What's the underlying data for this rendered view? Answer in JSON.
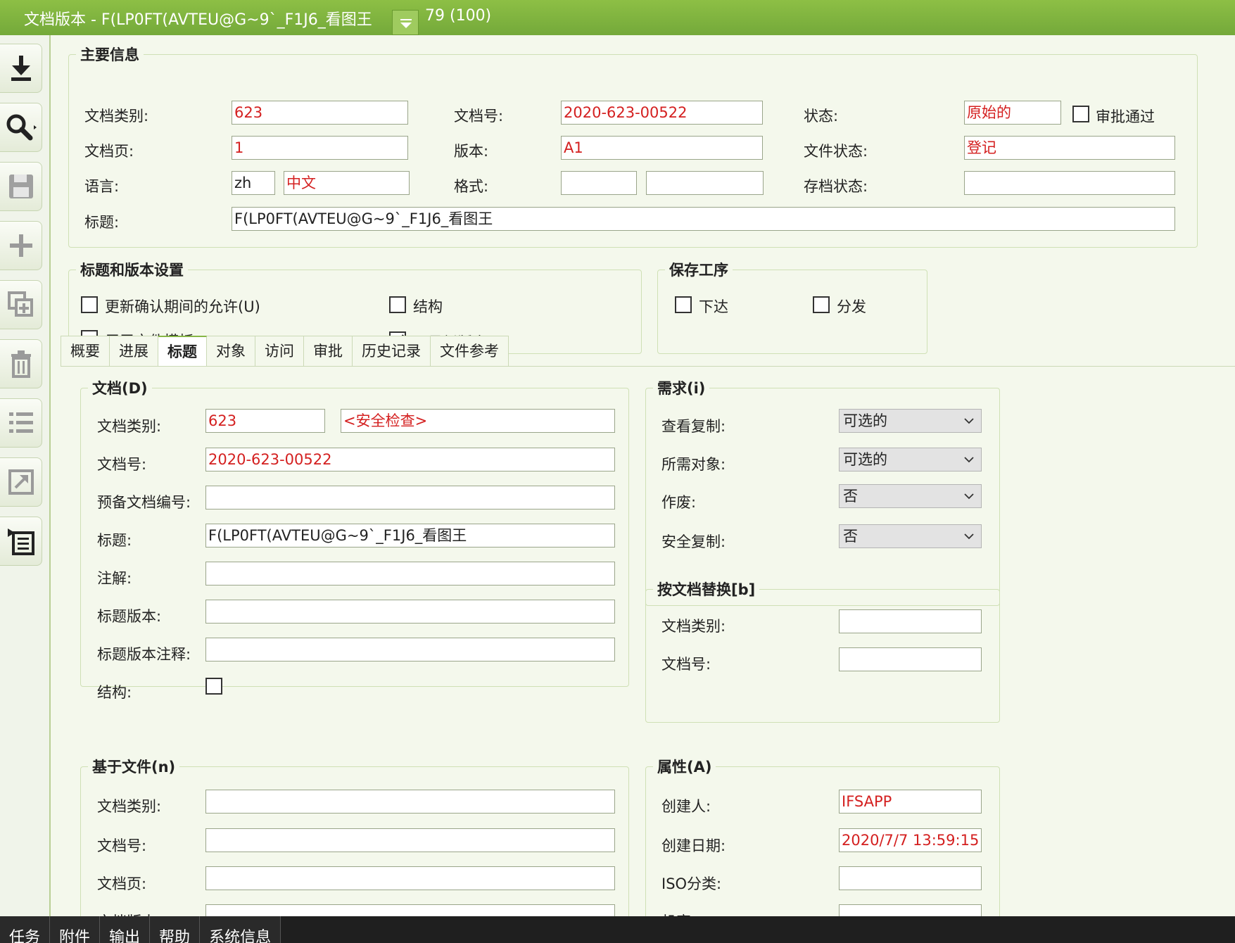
{
  "window": {
    "title": "文档版本 - F(LP0FT(AVTEU@G~9`_F1J6_看图王",
    "record_count": "79 (100)"
  },
  "toolbar": {
    "icons": [
      "download-icon",
      "search-icon",
      "save-icon",
      "add-icon",
      "duplicate-icon",
      "delete-icon",
      "list-icon",
      "export-icon",
      "details-icon"
    ]
  },
  "main_info": {
    "legend": "主要信息",
    "doc_class_label": "文档类别:",
    "doc_class": "623",
    "doc_no_label": "文档号:",
    "doc_no": "2020-623-00522",
    "status_label": "状态:",
    "status": "原始的",
    "approved_label": "审批通过",
    "approved": false,
    "doc_sheet_label": "文档页:",
    "doc_sheet": "1",
    "revision_label": "版本:",
    "revision": "A1",
    "file_status_label": "文件状态:",
    "file_status": "登记",
    "language_label": "语言:",
    "language_code": "zh",
    "language_name": "中文",
    "format_label": "格式:",
    "format_code": "",
    "format_name": "",
    "archive_status_label": "存档状态:",
    "archive_status": "",
    "title_label": "标题:",
    "title": "F(LP0FT(AVTEU@G~9`_F1J6_看图王"
  },
  "title_settings": {
    "legend": "标题和版本设置",
    "allow_update_label": "更新确认期间的允许(U)",
    "allow_update": false,
    "structure_label": "结构",
    "structure": false,
    "template_label": "用于文件模板",
    "template": false,
    "latest_label": "是最新版本",
    "latest": true
  },
  "save_process": {
    "legend": "保存工序",
    "release_label": "下达",
    "release": false,
    "distribute_label": "分发",
    "distribute": false
  },
  "tabs": [
    "概要",
    "进展",
    "标题",
    "对象",
    "访问",
    "审批",
    "历史记录",
    "文件参考"
  ],
  "active_tab": "标题",
  "document": {
    "legend": "文档(D)",
    "doc_class_label": "文档类别:",
    "doc_class": "623",
    "doc_class_desc": "<安全检查>",
    "doc_no_label": "文档号:",
    "doc_no": "2020-623-00522",
    "reserve_no_label": "预备文档编号:",
    "reserve_no": "",
    "title_label": "标题:",
    "title": "F(LP0FT(AVTEU@G~9`_F1J6_看图王",
    "note_label": "注解:",
    "note": "",
    "title_rev_label": "标题版本:",
    "title_rev": "",
    "title_rev_note_label": "标题版本注释:",
    "title_rev_note": "",
    "structure_label": "结构:",
    "structure": false
  },
  "requirements": {
    "legend": "需求(i)",
    "view_copy_label": "查看复制:",
    "view_copy": "可选的",
    "required_object_label": "所需对象:",
    "required_object": "可选的",
    "obsolete_label": "作废:",
    "obsolete": "否",
    "safety_copy_label": "安全复制:",
    "safety_copy": "否"
  },
  "replace_by": {
    "legend": "按文档替换[b]",
    "doc_class_label": "文档类别:",
    "doc_class": "",
    "doc_no_label": "文档号:",
    "doc_no": ""
  },
  "based_on": {
    "legend": "基于文件(n)",
    "doc_class_label": "文档类别:",
    "doc_class": "",
    "doc_no_label": "文档号:",
    "doc_no": "",
    "doc_sheet_label": "文档页:",
    "doc_sheet": "",
    "doc_rev_label": "文档版本:",
    "doc_rev": ""
  },
  "attributes": {
    "legend": "属性(A)",
    "created_by_label": "创建人:",
    "created_by": "IFSAPP",
    "created_date_label": "创建日期:",
    "created_date": "2020/7/7 13:59:15",
    "iso_class_label": "ISO分类:",
    "iso_class": "",
    "confidential_label": "机密:",
    "confidential": ""
  },
  "bottom_bar": [
    "任务",
    "附件",
    "输出",
    "帮助",
    "系统信息"
  ],
  "colors": {
    "title_bar": "#7fb33f",
    "required_text": "#d42020",
    "panel_bg": "#f4f8ec"
  }
}
